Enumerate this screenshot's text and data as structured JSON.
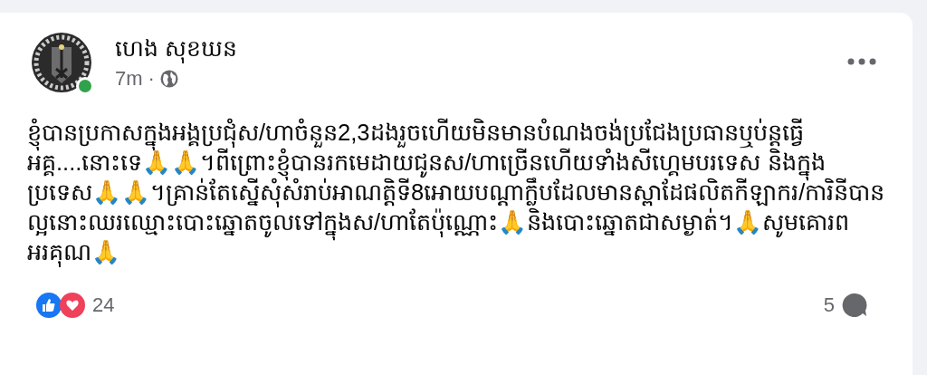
{
  "post": {
    "author": {
      "name": "ហេង សុខឃន",
      "online": true
    },
    "time": "7m",
    "separator": "·",
    "text": "ខ្ញុំបានប្រកាសក្នុងអង្គប្រជុំស/ហាចំនួន2,3ដងរួចហើយមិនមានបំណងចង់ប្រជែងប្រធានឬប់ន្តធ្វើអគ្គ....នោះទេ🙏🙏។ពីព្រោះខ្ញុំបានរកមេដាយជូនស/ហាច្រើនហើយទាំងសីហ្គេមបរទេស និងក្នុងប្រទេស🙏🙏។គ្រាន់តែស្នើសុំសំរាប់អាណត្តិទី8អោយបណ្ដាក្លឹបដែលមានស្ពាដែផលិតកីឡាករ/ការិនីបានល្អនោះឈរឈ្មោះបោះឆ្នោតចូលទៅក្នុងស/ហាតែប៉ុណ្ណោះ🙏និងបោះឆ្នោតជាសម្ងាត់។🙏សូមគោរពអរគុណ🙏",
    "reaction_count": "24",
    "comment_count": "5"
  }
}
